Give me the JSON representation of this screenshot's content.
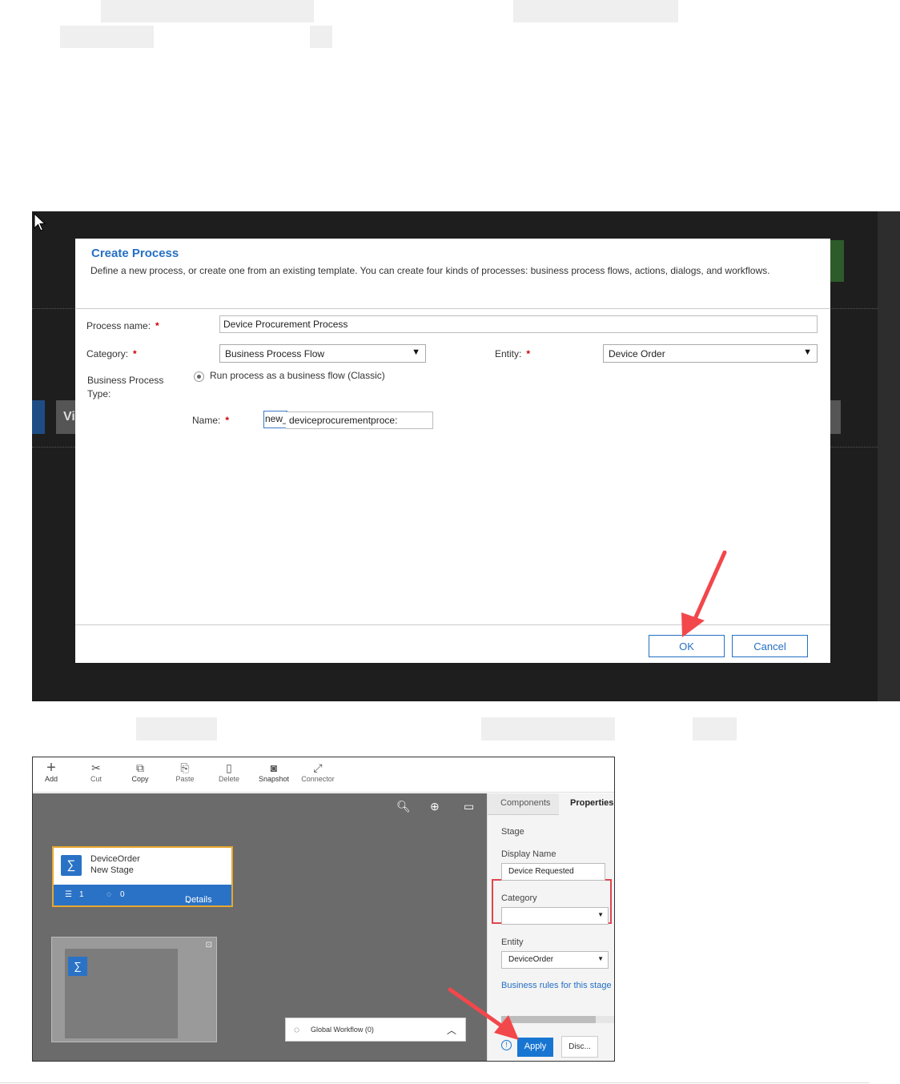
{
  "dialog": {
    "title": "Create Process",
    "description": "Define a new process, or create one from an existing template. You can create four kinds of processes: business process flows, actions, dialogs, and workflows.",
    "process_name_label": "Process name:",
    "process_name_value": "Device Procurement Process",
    "category_label": "Category:",
    "category_value": "Business Process Flow",
    "entity_label": "Entity:",
    "entity_value": "Device Order",
    "bp_type_label_1": "Business Process",
    "bp_type_label_2": "Type:",
    "bp_type_option": "Run process as a business flow (Classic)",
    "name_label": "Name:",
    "name_prefix": "new_",
    "name_value": "deviceprocurementproce:",
    "required_mark": "*",
    "ok_label": "OK",
    "cancel_label": "Cancel",
    "background_text": "Vi"
  },
  "designer": {
    "toolbar": [
      {
        "label": "Add",
        "icon": "add-icon",
        "glyph": "+"
      },
      {
        "label": "Cut",
        "icon": "cut-icon",
        "glyph": "✂"
      },
      {
        "label": "Copy",
        "icon": "copy-icon",
        "glyph": "⧉"
      },
      {
        "label": "Paste",
        "icon": "paste-icon",
        "glyph": "📋"
      },
      {
        "label": "Delete",
        "icon": "delete-icon",
        "glyph": "🗑"
      },
      {
        "label": "Snapshot",
        "icon": "camera-icon",
        "glyph": "◙"
      },
      {
        "label": "Connector",
        "icon": "connector-icon",
        "glyph": "⤢"
      }
    ],
    "stage": {
      "entity": "DeviceOrder",
      "name": "New Stage",
      "steps_count": "1",
      "workflow_count": "0",
      "details_label": "Details"
    },
    "global_workflow": "Global Workflow (0)",
    "panel": {
      "tab_components": "Components",
      "tab_properties": "Properties",
      "section": "Stage",
      "display_name_label": "Display Name",
      "display_name_value": "Device Requested",
      "category_label": "Category",
      "category_value": "",
      "entity_label": "Entity",
      "entity_value": "DeviceOrder",
      "business_rules_link": "Business rules for this stage",
      "apply_label": "Apply",
      "discard_label": "Disc..."
    }
  },
  "colors": {
    "accent": "#2570c4",
    "highlight": "#e0454f",
    "stage_border": "#e8a830"
  }
}
